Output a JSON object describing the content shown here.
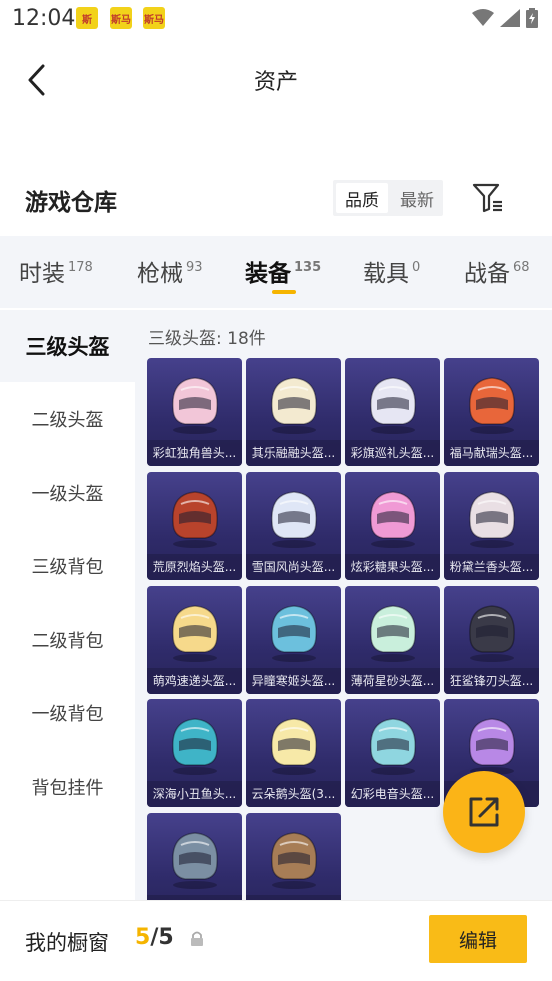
{
  "status_bar": {
    "time": "12:04",
    "apps": [
      "app-badge",
      "sima-badge",
      "sima-badge"
    ],
    "app_badge_labels": [
      "斯",
      "斯马",
      "斯马"
    ]
  },
  "header": {
    "title": "资产"
  },
  "section": {
    "title": "游戏仓库",
    "sort_options": [
      "品质",
      "最新"
    ],
    "active_sort": "品质"
  },
  "tabs": [
    {
      "label": "时装",
      "count": "178"
    },
    {
      "label": "枪械",
      "count": "93"
    },
    {
      "label": "装备",
      "count": "135",
      "active": true
    },
    {
      "label": "载具",
      "count": "0"
    },
    {
      "label": "战备",
      "count": "68"
    }
  ],
  "sidebar": [
    {
      "label": "三级头盔",
      "active": true
    },
    {
      "label": "二级头盔"
    },
    {
      "label": "一级头盔"
    },
    {
      "label": "三级背包"
    },
    {
      "label": "二级背包"
    },
    {
      "label": "一级背包"
    },
    {
      "label": "背包挂件"
    }
  ],
  "content": {
    "count_label": "三级头盔: 18件",
    "items": [
      {
        "name": "彩虹独角兽头...",
        "color": "#f2c6d8"
      },
      {
        "name": "其乐融融头盔...",
        "color": "#f3ead0"
      },
      {
        "name": "彩旗巡礼头盔...",
        "color": "#e6e6f3"
      },
      {
        "name": "福马献瑞头盔...",
        "color": "#e8663a"
      },
      {
        "name": "荒原烈焰头盔...",
        "color": "#b8432c"
      },
      {
        "name": "雪国风尚头盔...",
        "color": "#dfe6f6"
      },
      {
        "name": "炫彩糖果头盔...",
        "color": "#f09ad5"
      },
      {
        "name": "粉黛兰香头盔...",
        "color": "#e9dfe4"
      },
      {
        "name": "萌鸡速递头盔...",
        "color": "#f6d98b"
      },
      {
        "name": "异瞳寒姬头盔...",
        "color": "#6cc0dd"
      },
      {
        "name": "薄荷星砂头盔...",
        "color": "#c9efdc"
      },
      {
        "name": "狂鲨锋刃头盔...",
        "color": "#3a3a48"
      },
      {
        "name": "深海小丑鱼头...",
        "color": "#3fb4c7"
      },
      {
        "name": "云朵鹅头盔(3...",
        "color": "#f7e9a8"
      },
      {
        "name": "幻彩电音头盔...",
        "color": "#8fd6e0"
      },
      {
        "name": "...",
        "color": "#b888e6"
      },
      {
        "name": "",
        "color": "#7b8fa3"
      },
      {
        "name": "",
        "color": "#a77d56"
      }
    ]
  },
  "bottom_bar": {
    "label": "我的橱窗",
    "current": "5",
    "separator": "/",
    "total": "5",
    "edit_label": "编辑"
  },
  "colors": {
    "accent": "#f5b400",
    "card_bg": "#3a357a",
    "panel_bg": "#f3f5f9"
  }
}
